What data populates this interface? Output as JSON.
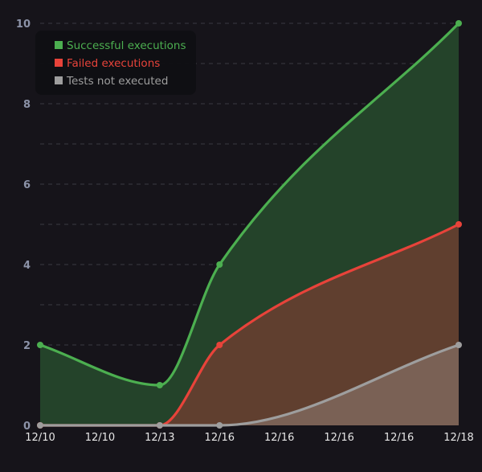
{
  "chart_data": {
    "type": "area",
    "title": "",
    "xlabel": "",
    "ylabel": "",
    "ylim": [
      0,
      10
    ],
    "y_ticks": [
      0,
      2,
      4,
      6,
      8,
      10
    ],
    "x_tick_labels": [
      "12/10",
      "12/10",
      "12/13",
      "12/16",
      "12/16",
      "12/16",
      "12/16",
      "12/18"
    ],
    "grid": true,
    "legend_position": "top-left",
    "series": [
      {
        "name": "Successful executions",
        "color": "#4caf50",
        "fill": "#24432a",
        "points": [
          {
            "x": 0,
            "y": 2
          },
          {
            "x": 2,
            "y": 1
          },
          {
            "x": 3,
            "y": 4
          },
          {
            "x": 7,
            "y": 10
          }
        ]
      },
      {
        "name": "Failed executions",
        "color": "#e8433a",
        "fill": "#603f2f",
        "points": [
          {
            "x": 0,
            "y": 0
          },
          {
            "x": 2,
            "y": 0
          },
          {
            "x": 3,
            "y": 2
          },
          {
            "x": 7,
            "y": 5
          }
        ]
      },
      {
        "name": "Tests not executed",
        "color": "#9e9e9e",
        "fill": "#7a6155",
        "points": [
          {
            "x": 0,
            "y": 0
          },
          {
            "x": 2,
            "y": 0
          },
          {
            "x": 3,
            "y": 0
          },
          {
            "x": 7,
            "y": 2
          }
        ]
      }
    ]
  }
}
